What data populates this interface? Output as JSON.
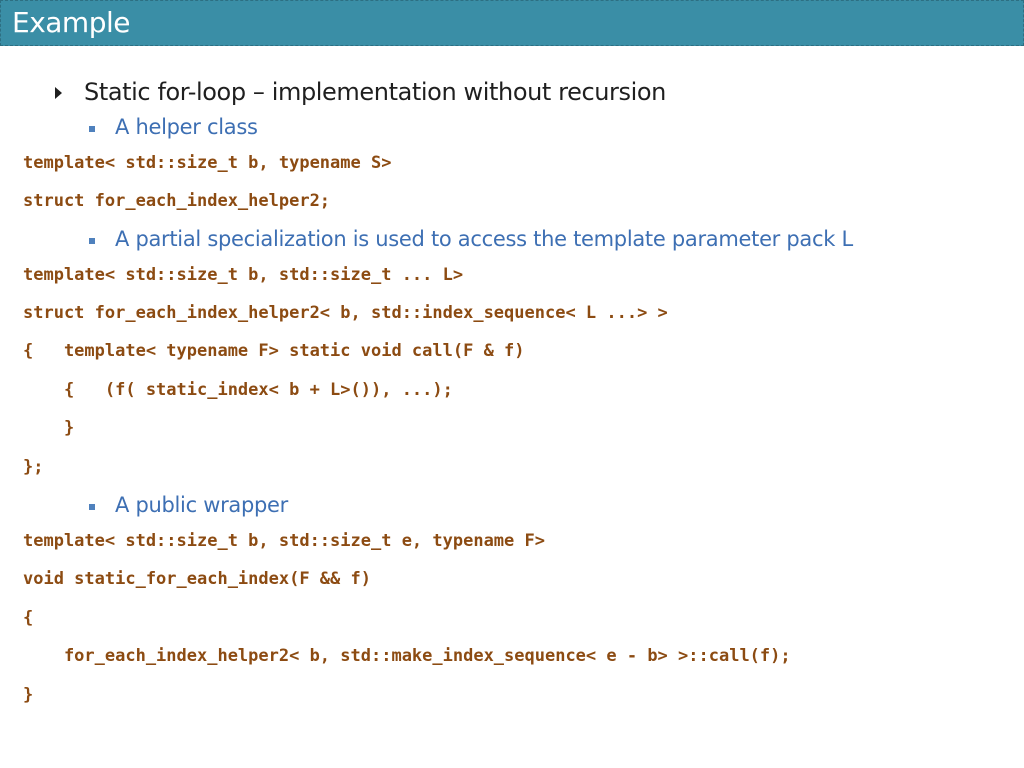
{
  "header": {
    "title": "Example"
  },
  "bullet": {
    "text": "Static for-loop – implementation without recursion"
  },
  "subbullets": [
    "A helper class",
    "A partial specialization is used to access the template parameter pack L",
    "A public wrapper"
  ],
  "code": {
    "helper": [
      "template< std::size_t b, typename S>",
      "struct for_each_index_helper2;"
    ],
    "specialization": [
      "template< std::size_t b, std::size_t ... L>",
      "struct for_each_index_helper2< b, std::index_sequence< L ...> >",
      "{   template< typename F> static void call(F & f)",
      "    {   (f( static_index< b + L>()), ...);",
      "    }",
      "};"
    ],
    "wrapper": [
      "template< std::size_t b, std::size_t e, typename F>",
      "void static_for_each_index(F && f)",
      "{",
      "    for_each_index_helper2< b, std::make_index_sequence< e - b> >::call(f);",
      "}"
    ]
  },
  "colors": {
    "title_bar": "#3a8ea6",
    "code": "#8c4b12",
    "subbullet": "#3d6fb3",
    "square_bullet": "#4f81bd"
  }
}
